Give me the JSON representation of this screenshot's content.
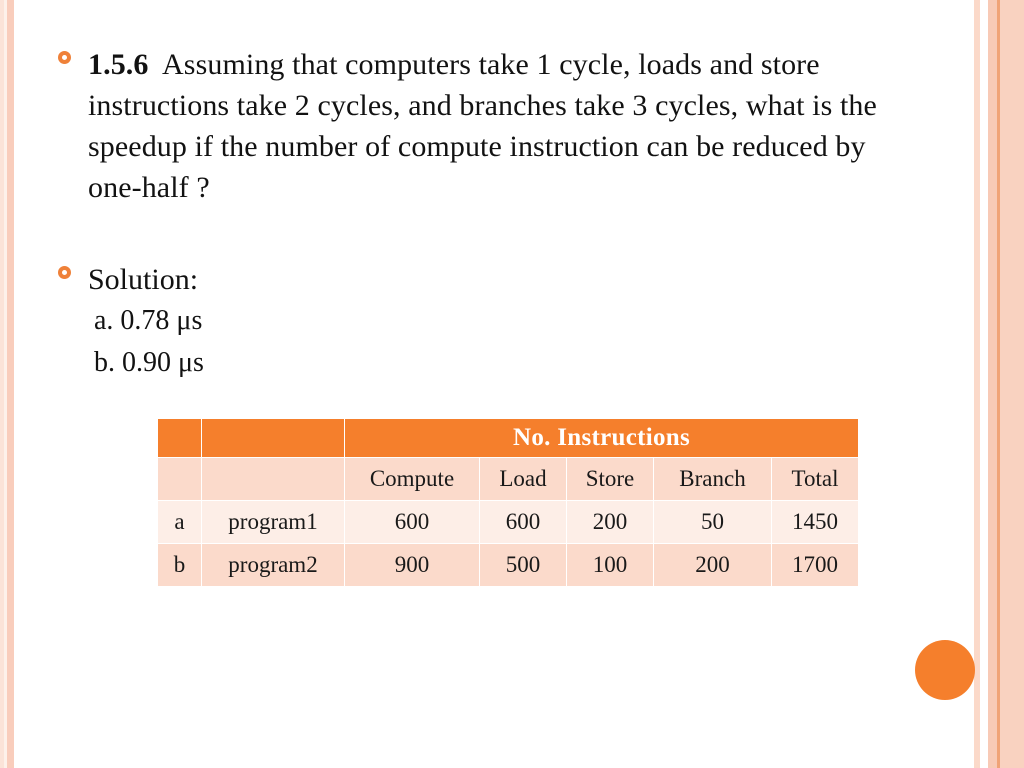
{
  "slide": {
    "question": {
      "number": "1.5.6",
      "text": "Assuming that computers take 1 cycle, loads and store instructions take 2 cycles, and branches take 3 cycles, what is the speedup if the number of compute instruction can be reduced by one-half ?"
    },
    "solution_label": "Solution:",
    "answers": [
      "a. 0.78 μs",
      "b. 0.90 μs"
    ],
    "bullet_icon": "ring-bullet-icon",
    "accent_color": "#f57f2c"
  },
  "table": {
    "group_header": "No. Instructions",
    "columns": [
      "",
      "",
      "Compute",
      "Load",
      "Store",
      "Branch",
      "Total"
    ],
    "rows": [
      {
        "index": "a",
        "name": "program1",
        "compute": "600",
        "load": "600",
        "store": "200",
        "branch": "50",
        "total": "1450"
      },
      {
        "index": "b",
        "name": "program2",
        "compute": "900",
        "load": "500",
        "store": "100",
        "branch": "200",
        "total": "1700"
      }
    ]
  }
}
